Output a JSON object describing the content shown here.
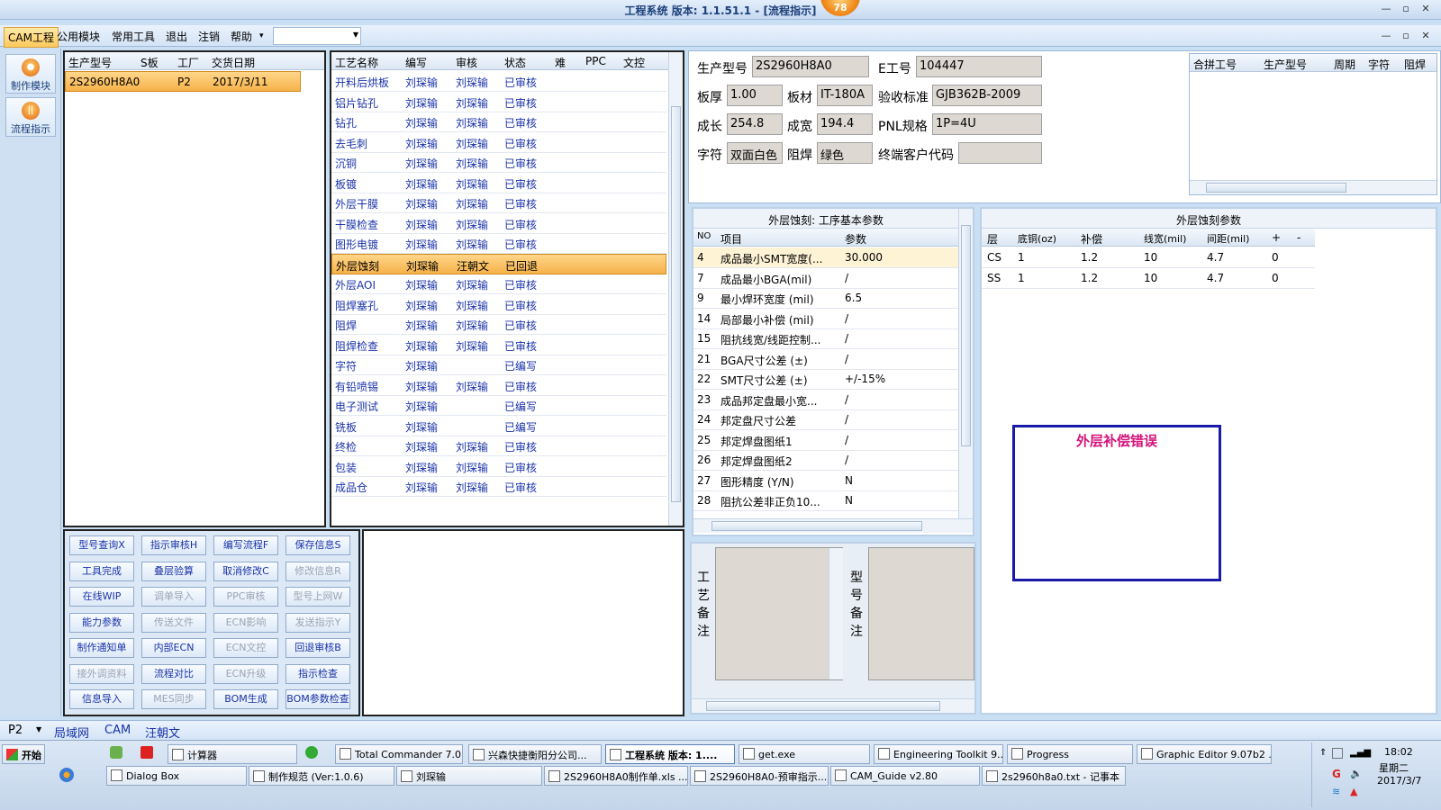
{
  "window": {
    "title": "工程系统   版本: 1.1.51.1 - [流程指示]",
    "badge": "78",
    "min": "—",
    "max": "▫",
    "close": "✕"
  },
  "menubar": {
    "items": [
      "CAM工程",
      "公用模块",
      "常用工具",
      "退出",
      "注销",
      "帮助"
    ],
    "help_arrow": "▾",
    "combo_value": ""
  },
  "leftnav": {
    "items": [
      "制作模块",
      "流程指示"
    ]
  },
  "orders": {
    "headers": [
      "生产型号",
      "S板",
      "工厂",
      "交货日期"
    ],
    "rows": [
      {
        "model": "2S2960H8A0",
        "s": "",
        "factory": "P2",
        "date": "2017/3/11"
      }
    ]
  },
  "process": {
    "headers": [
      "工艺名称",
      "编写",
      "审核",
      "状态",
      "难",
      "PPC",
      "文控"
    ],
    "rows": [
      {
        "name": "开料后烘板",
        "writer": "刘琛输",
        "reviewer": "刘琛输",
        "status": "已审核"
      },
      {
        "name": "铝片钻孔",
        "writer": "刘琛输",
        "reviewer": "刘琛输",
        "status": "已审核"
      },
      {
        "name": "钻孔",
        "writer": "刘琛输",
        "reviewer": "刘琛输",
        "status": "已审核"
      },
      {
        "name": "去毛刺",
        "writer": "刘琛输",
        "reviewer": "刘琛输",
        "status": "已审核"
      },
      {
        "name": "沉铜",
        "writer": "刘琛输",
        "reviewer": "刘琛输",
        "status": "已审核"
      },
      {
        "name": "板镀",
        "writer": "刘琛输",
        "reviewer": "刘琛输",
        "status": "已审核"
      },
      {
        "name": "外层干膜",
        "writer": "刘琛输",
        "reviewer": "刘琛输",
        "status": "已审核"
      },
      {
        "name": "干膜检查",
        "writer": "刘琛输",
        "reviewer": "刘琛输",
        "status": "已审核"
      },
      {
        "name": "图形电镀",
        "writer": "刘琛输",
        "reviewer": "刘琛输",
        "status": "已审核"
      },
      {
        "name": "外层蚀刻",
        "writer": "刘琛输",
        "reviewer": "汪朝文",
        "status": "已回退"
      },
      {
        "name": "外层AOI",
        "writer": "刘琛输",
        "reviewer": "刘琛输",
        "status": "已审核"
      },
      {
        "name": "阻焊塞孔",
        "writer": "刘琛输",
        "reviewer": "刘琛输",
        "status": "已审核"
      },
      {
        "name": "阻焊",
        "writer": "刘琛输",
        "reviewer": "刘琛输",
        "status": "已审核"
      },
      {
        "name": "阻焊检查",
        "writer": "刘琛输",
        "reviewer": "刘琛输",
        "status": "已审核"
      },
      {
        "name": "字符",
        "writer": "刘琛输",
        "reviewer": "",
        "status": "已编写"
      },
      {
        "name": "有铅喷锡",
        "writer": "刘琛输",
        "reviewer": "刘琛输",
        "status": "已审核"
      },
      {
        "name": "电子测试",
        "writer": "刘琛输",
        "reviewer": "",
        "status": "已编写"
      },
      {
        "name": "铣板",
        "writer": "刘琛输",
        "reviewer": "",
        "status": "已编写"
      },
      {
        "name": "终检",
        "writer": "刘琛输",
        "reviewer": "刘琛输",
        "status": "已审核"
      },
      {
        "name": "包装",
        "writer": "刘琛输",
        "reviewer": "刘琛输",
        "status": "已审核"
      },
      {
        "name": "成品仓",
        "writer": "刘琛输",
        "reviewer": "刘琛输",
        "status": "已审核"
      }
    ]
  },
  "buttons": [
    {
      "label": "型号查询X",
      "enabled": true
    },
    {
      "label": "指示审核H",
      "enabled": true
    },
    {
      "label": "编写流程F",
      "enabled": true
    },
    {
      "label": "保存信息S",
      "enabled": true
    },
    {
      "label": "工具完成",
      "enabled": true
    },
    {
      "label": "叠层验算",
      "enabled": true
    },
    {
      "label": "取消修改C",
      "enabled": true
    },
    {
      "label": "修改信息R",
      "enabled": false
    },
    {
      "label": "在线WIP",
      "enabled": true
    },
    {
      "label": "调单导入",
      "enabled": false
    },
    {
      "label": "PPC审核",
      "enabled": false
    },
    {
      "label": "型号上网W",
      "enabled": false
    },
    {
      "label": "能力参数",
      "enabled": true
    },
    {
      "label": "传送文件",
      "enabled": false
    },
    {
      "label": "ECN影响",
      "enabled": false
    },
    {
      "label": "发送指示Y",
      "enabled": false
    },
    {
      "label": "制作通知单",
      "enabled": true
    },
    {
      "label": "内部ECN",
      "enabled": true
    },
    {
      "label": "ECN文控",
      "enabled": false
    },
    {
      "label": "回退审核B",
      "enabled": true
    },
    {
      "label": "接外调资料",
      "enabled": false
    },
    {
      "label": "流程对比",
      "enabled": true
    },
    {
      "label": "ECN升级",
      "enabled": false
    },
    {
      "label": "指示检查",
      "enabled": true
    },
    {
      "label": "信息导入",
      "enabled": true
    },
    {
      "label": "MES同步",
      "enabled": false
    },
    {
      "label": "BOM生成",
      "enabled": true
    },
    {
      "label": "BOM参数检查",
      "enabled": true
    }
  ],
  "info": {
    "model_label": "生产型号",
    "model": "2S2960H8A0",
    "eno_label": "E工号",
    "eno": "104447",
    "thick_label": "板厚",
    "thick": "1.00",
    "material_label": "板材",
    "material": "IT-180A",
    "std_label": "验收标准",
    "std": "GJB362B-2009",
    "len_label": "成长",
    "len": "254.8",
    "wid_label": "成宽",
    "wid": "194.4",
    "pnl_label": "PNL规格",
    "pnl": "1P=4U",
    "char_label": "字符",
    "char": "双面白色",
    "mask_label": "阻焊",
    "mask": "绿色",
    "cust_label": "终端客户代码",
    "cust": ""
  },
  "combine": {
    "headers": [
      "合拼工号",
      "生产型号",
      "周期",
      "字符",
      "阻焊"
    ]
  },
  "params": {
    "title": "外层蚀刻: 工序基本参数",
    "headers": [
      "NO",
      "项目",
      "参数"
    ],
    "rows": [
      {
        "no": "4",
        "item": "成品最小SMT宽度(...",
        "val": "30.000"
      },
      {
        "no": "7",
        "item": "成品最小BGA(mil)",
        "val": "/"
      },
      {
        "no": "9",
        "item": "最小焊环宽度 (mil)",
        "val": "6.5"
      },
      {
        "no": "14",
        "item": "局部最小补偿 (mil)",
        "val": "/"
      },
      {
        "no": "15",
        "item": "阻抗线宽/线距控制...",
        "val": "/"
      },
      {
        "no": "21",
        "item": "BGA尺寸公差 (±)",
        "val": "/"
      },
      {
        "no": "22",
        "item": "SMT尺寸公差 (±)",
        "val": "+/-15%"
      },
      {
        "no": "23",
        "item": "成品邦定盘最小宽...",
        "val": "/"
      },
      {
        "no": "24",
        "item": "邦定盘尺寸公差",
        "val": "/"
      },
      {
        "no": "25",
        "item": "邦定焊盘图纸1",
        "val": "/"
      },
      {
        "no": "26",
        "item": "邦定焊盘图纸2",
        "val": "/"
      },
      {
        "no": "27",
        "item": "图形精度 (Y/N)",
        "val": "N"
      },
      {
        "no": "28",
        "item": "阻抗公差非正负10...",
        "val": "N"
      }
    ]
  },
  "etch": {
    "title": "外层蚀刻参数",
    "headers": [
      "层",
      "底铜(oz)",
      "补偿",
      "线宽(mil)",
      "间距(mil)",
      "+",
      "-"
    ],
    "rows": [
      {
        "layer": "CS",
        "cu": "1",
        "comp": "1.2",
        "lw": "10",
        "sp": "4.7",
        "plus": "0",
        "minus": ""
      },
      {
        "layer": "SS",
        "cu": "1",
        "comp": "1.2",
        "lw": "10",
        "sp": "4.7",
        "plus": "0",
        "minus": ""
      }
    ]
  },
  "error_box": {
    "text": "外层补偿错误"
  },
  "notes": {
    "process_label": "工艺备注",
    "model_label": "型号备注"
  },
  "statusbar": {
    "factory": "P2",
    "items": [
      "局域网",
      "CAM",
      "汪朝文"
    ]
  },
  "taskbar": {
    "start": "开始",
    "row1": [
      "计算器",
      "Total Commander 7.0 ...",
      "兴森快捷衡阳分公司...",
      "工程系统  版本: 1....",
      "get.exe",
      "Engineering Toolkit 9....",
      "Progress",
      "Graphic Editor 9.07b2 ..."
    ],
    "row2": [
      "Dialog Box",
      "制作规范 (Ver:1.0.6)",
      "刘琛输",
      "2S2960H8A0制作单.xls ...",
      "2S2960H8A0-预审指示....",
      "CAM_Guide v2.80",
      "2s2960h8a0.txt - 记事本"
    ],
    "time": "18:02",
    "weekday": "星期二",
    "date": "2017/3/7"
  },
  "colors": {
    "accent": "#f6b24a",
    "title": "#1c3f7a",
    "error": "#d4127a",
    "border": "#1a1aa8"
  }
}
